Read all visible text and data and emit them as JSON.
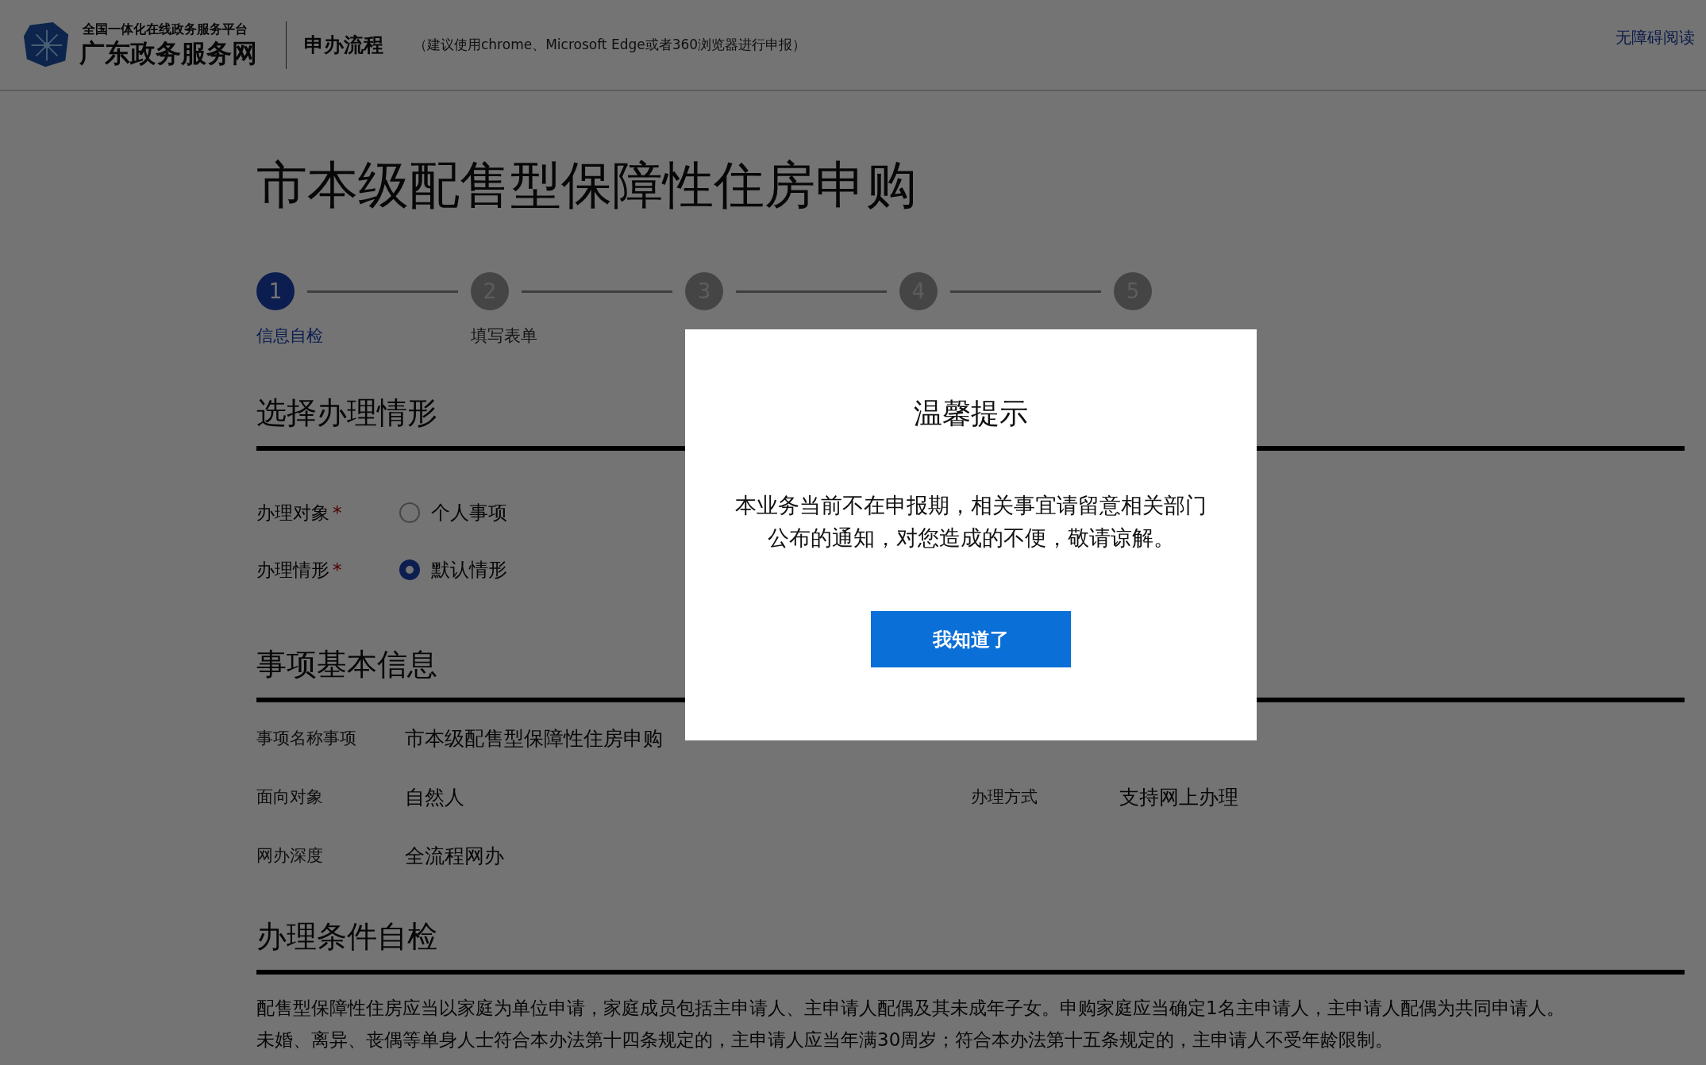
{
  "header": {
    "platform": "全国一体化在线政务服务平台",
    "site_name": "广东政务服务网",
    "section": "申办流程",
    "browser_hint": "（建议使用chrome、Microsoft Edge或者360浏览器进行申报）",
    "accessibility_link": "无障碍阅读"
  },
  "page_title": "市本级配售型保障性住房申购",
  "steps": [
    {
      "number": "1",
      "label": "信息自检",
      "selected": true
    },
    {
      "number": "2",
      "label": "填写表单",
      "selected": false
    },
    {
      "number": "3",
      "selected": false
    },
    {
      "number": "4",
      "selected": false
    },
    {
      "number": "5",
      "selected": false
    }
  ],
  "sections": [
    {
      "kind": "form",
      "title": "选择办理情形",
      "fields": [
        {
          "label": "办理对象",
          "required_mark": "*",
          "options": [
            {
              "label": "个人事项",
              "selected": false
            }
          ]
        },
        {
          "label": "办理情形",
          "required_mark": "*",
          "options": [
            {
              "label": "默认情形",
              "selected": true
            }
          ]
        }
      ]
    },
    {
      "kind": "info",
      "title": "事项基本信息",
      "rows": [
        [
          {
            "label": "事项名称事项",
            "value": "市本级配售型保障性住房申购"
          }
        ],
        [
          {
            "label": "面向对象",
            "value": "自然人"
          },
          {
            "label": "办理方式",
            "value": "支持网上办理"
          }
        ],
        [
          {
            "label": "网办深度",
            "value": "全流程网办"
          }
        ]
      ]
    },
    {
      "kind": "text",
      "title": "办理条件自检",
      "paragraphs": [
        "配售型保障性住房应当以家庭为单位申请，家庭成员包括主申请人、主申请人配偶及其未成年子女。申购家庭应当确定1名主申请人，主申请人配偶为共同申请人。",
        "未婚、离异、丧偶等单身人士符合本办法第十四条规定的，主申请人应当年满30周岁；符合本办法第十五条规定的，主申请人不受年龄限制。"
      ]
    }
  ],
  "dialog": {
    "title": "温馨提示",
    "message": "本业务当前不在申报期，相关事宜请留意相关部门公布的通知，对您造成的不便，敬请谅解。",
    "button": "我知道了"
  }
}
